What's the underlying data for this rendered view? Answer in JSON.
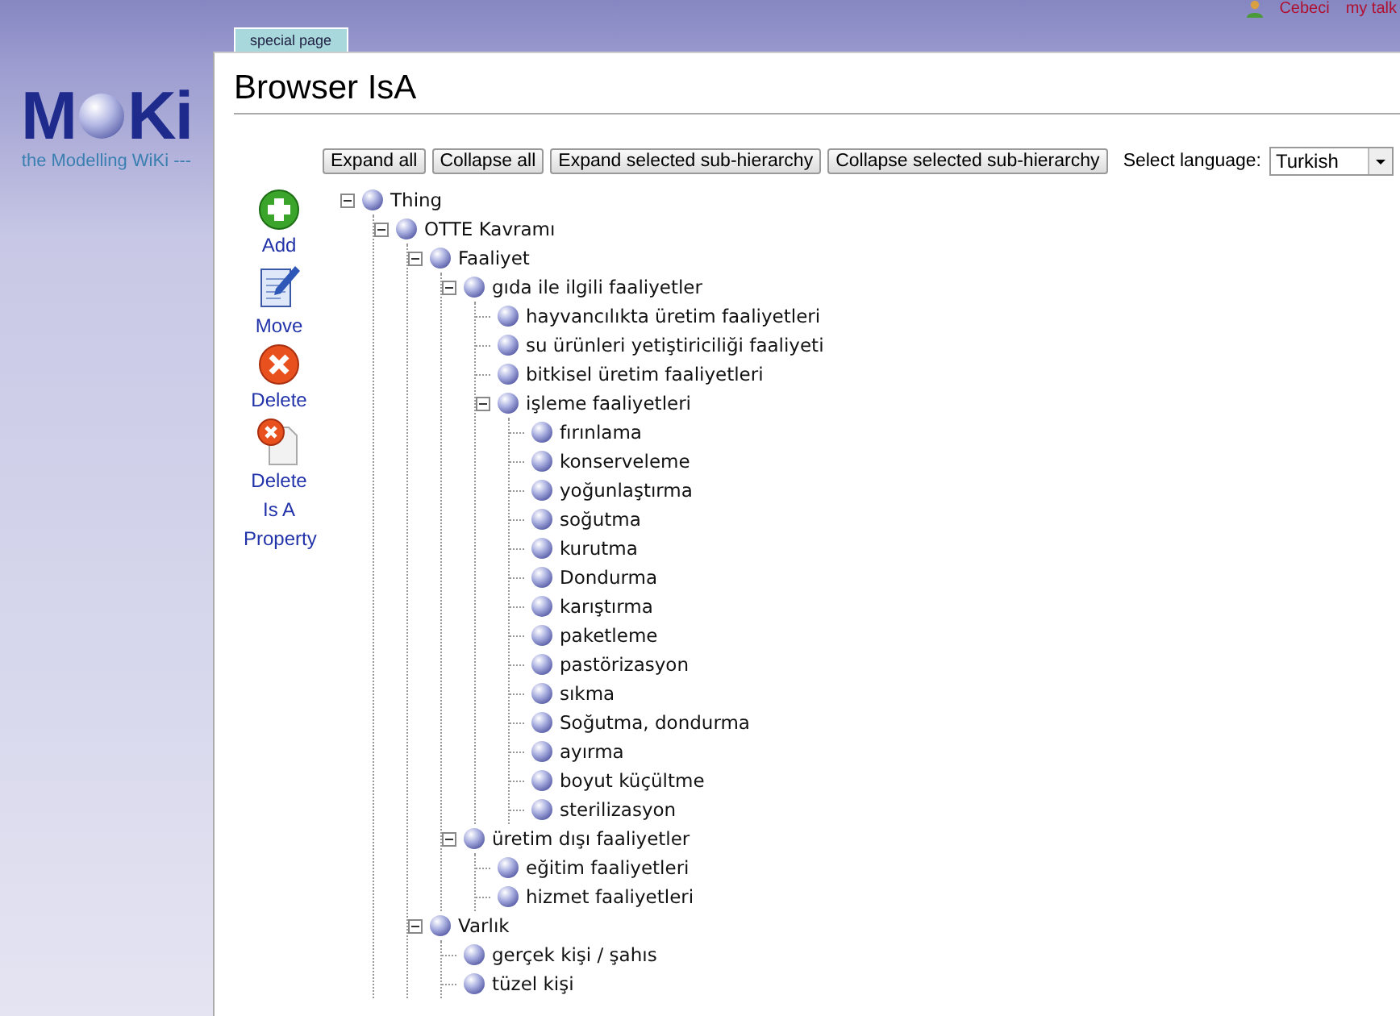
{
  "logo": {
    "left": "M",
    "right": "Ki",
    "tagline": "the Modelling WiKi ---"
  },
  "tab": {
    "label": "special page",
    "selected": true
  },
  "user_links": [
    "Cebeci",
    "my talk"
  ],
  "title": "Browser IsA",
  "toolbar": {
    "buttons": [
      "Expand all",
      "Collapse all",
      "Expand selected sub-hierarchy",
      "Collapse selected sub-hierarchy"
    ],
    "language_label": "Select language:",
    "language": "Turkish"
  },
  "actions": [
    {
      "kind": "add",
      "label": "Add"
    },
    {
      "kind": "move",
      "label": "Move"
    },
    {
      "kind": "delete",
      "label": "Delete"
    },
    {
      "kind": "delete-property",
      "label": "Delete Is A Property"
    }
  ],
  "tree": [
    {
      "label": "Thing",
      "expanded": true,
      "children": [
        {
          "label": "OTTE Kavramı",
          "expanded": true,
          "children": [
            {
              "label": "Faaliyet",
              "expanded": true,
              "children": [
                {
                  "label": "gıda ile ilgili faaliyetler",
                  "expanded": true,
                  "children": [
                    {
                      "label": "hayvancılıkta üretim faaliyetleri"
                    },
                    {
                      "label": "su ürünleri yetiştiriciliği faaliyeti"
                    },
                    {
                      "label": "bitkisel üretim faaliyetleri"
                    },
                    {
                      "label": "işleme faaliyetleri",
                      "expanded": true,
                      "children": [
                        {
                          "label": "fırınlama"
                        },
                        {
                          "label": "konserveleme"
                        },
                        {
                          "label": "yoğunlaştırma"
                        },
                        {
                          "label": "soğutma"
                        },
                        {
                          "label": "kurutma"
                        },
                        {
                          "label": "Dondurma"
                        },
                        {
                          "label": "karıştırma"
                        },
                        {
                          "label": "paketleme"
                        },
                        {
                          "label": "pastörizasyon"
                        },
                        {
                          "label": "sıkma"
                        },
                        {
                          "label": "Soğutma, dondurma"
                        },
                        {
                          "label": "ayırma"
                        },
                        {
                          "label": "boyut küçültme"
                        },
                        {
                          "label": "sterilizasyon"
                        }
                      ]
                    }
                  ]
                },
                {
                  "label": "üretim dışı faaliyetler",
                  "expanded": true,
                  "children": [
                    {
                      "label": "eğitim faaliyetleri"
                    },
                    {
                      "label": "hizmet faaliyetleri"
                    }
                  ]
                }
              ]
            },
            {
              "label": "Varlık",
              "expanded": true,
              "children": [
                {
                  "label": "gerçek kişi / şahıs"
                },
                {
                  "label": "tüzel kişi"
                }
              ]
            }
          ]
        }
      ]
    }
  ]
}
